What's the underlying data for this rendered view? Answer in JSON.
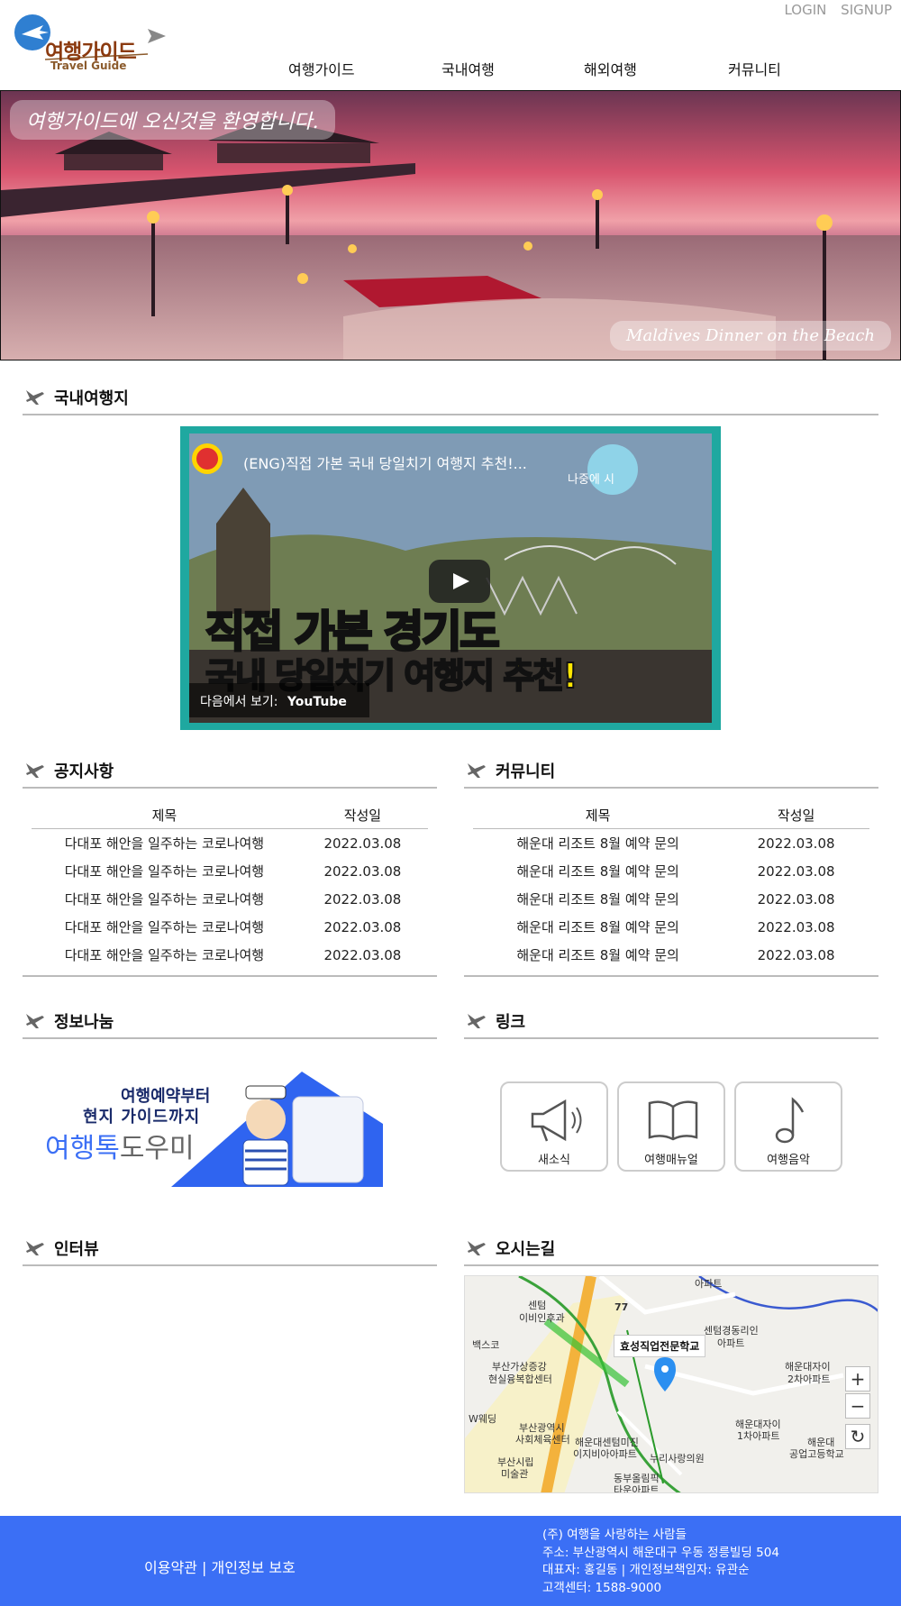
{
  "header": {
    "login": "LOGIN",
    "signup": "SIGNUP",
    "logo_text": "여행가이드",
    "logo_sub": "Travel Guide",
    "nav": [
      "여행가이드",
      "국내여행",
      "해외여행",
      "커뮤니티"
    ]
  },
  "hero": {
    "welcome": "여행가이드에 오신것을 환영합니다.",
    "caption": "Maldives Dinner on the Beach"
  },
  "domestic": {
    "title": "국내여행지",
    "video": {
      "title": "(ENG)직접 가본 국내 당일치기 여행지 추천!...",
      "later": "나중에 시",
      "thumb_line1": "직접 가본 경기도",
      "thumb_line2": "국내 당일치기 여행지 추천!",
      "watch_on": "다음에서 보기:",
      "youtube": "YouTube"
    }
  },
  "notice": {
    "title": "공지사항",
    "col_title": "제목",
    "col_date": "작성일",
    "rows": [
      {
        "title": "다대포 해안을 일주하는 코로나여행",
        "date": "2022.03.08"
      },
      {
        "title": "다대포 해안을 일주하는 코로나여행",
        "date": "2022.03.08"
      },
      {
        "title": "다대포 해안을 일주하는 코로나여행",
        "date": "2022.03.08"
      },
      {
        "title": "다대포 해안을 일주하는 코로나여행",
        "date": "2022.03.08"
      },
      {
        "title": "다대포 해안을 일주하는 코로나여행",
        "date": "2022.03.08"
      }
    ]
  },
  "community": {
    "title": "커뮤니티",
    "col_title": "제목",
    "col_date": "작성일",
    "rows": [
      {
        "title": "해운대 리조트 8월 예약 문의",
        "date": "2022.03.08"
      },
      {
        "title": "해운대 리조트 8월 예약 문의",
        "date": "2022.03.08"
      },
      {
        "title": "해운대 리조트 8월 예약 문의",
        "date": "2022.03.08"
      },
      {
        "title": "해운대 리조트 8월 예약 문의",
        "date": "2022.03.08"
      },
      {
        "title": "해운대 리조트 8월 예약 문의",
        "date": "2022.03.08"
      }
    ]
  },
  "info": {
    "title": "정보나눔",
    "banner_line1": "여행예약부터",
    "banner_line2": "현지 가이드까지",
    "banner_brand_blue": "여행톡",
    "banner_brand_gray": "도우미"
  },
  "links": {
    "title": "링크",
    "items": [
      {
        "label": "새소식",
        "icon": "megaphone-icon"
      },
      {
        "label": "여행매뉴얼",
        "icon": "book-icon"
      },
      {
        "label": "여행음악",
        "icon": "music-note-icon"
      }
    ]
  },
  "interview": {
    "title": "인터뷰"
  },
  "directions": {
    "title": "오시는길",
    "marker_label": "효성직업전문학교",
    "map_labels": [
      "아파트",
      "센텀",
      "이비인후과",
      "백스코",
      "센텀경동리인",
      "아파트",
      "부산가상증강",
      "현실융복합센터",
      "해운대자이",
      "2차아파트",
      "W웨딩",
      "부산광역시",
      "사회체육센터",
      "해운대센텀미진",
      "이지비아아파트",
      "해운대자이",
      "1차아파트",
      "해운대",
      "공업고등학교",
      "부산시립",
      "미술관",
      "누리사랑의원",
      "동부올림픽",
      "타운아파트",
      "77"
    ],
    "zoom_in": "+",
    "zoom_out": "−",
    "reset": "↻"
  },
  "footer": {
    "terms": "이용약관",
    "sep": "|",
    "privacy": "개인정보 보호",
    "company": "(주) 여행을 사랑하는 사람들",
    "address": "주소: 부산광역시 해운대구 우동 정릉빌딩 504",
    "ceo": "대표자: 홍길동 | 개인정보책임자: 유관순",
    "cs": "고객센터: 1588-9000"
  },
  "colors": {
    "accent": "#3b6ff5",
    "video_frame": "#1fa8a0",
    "logo_brown": "#8b3a0f"
  }
}
